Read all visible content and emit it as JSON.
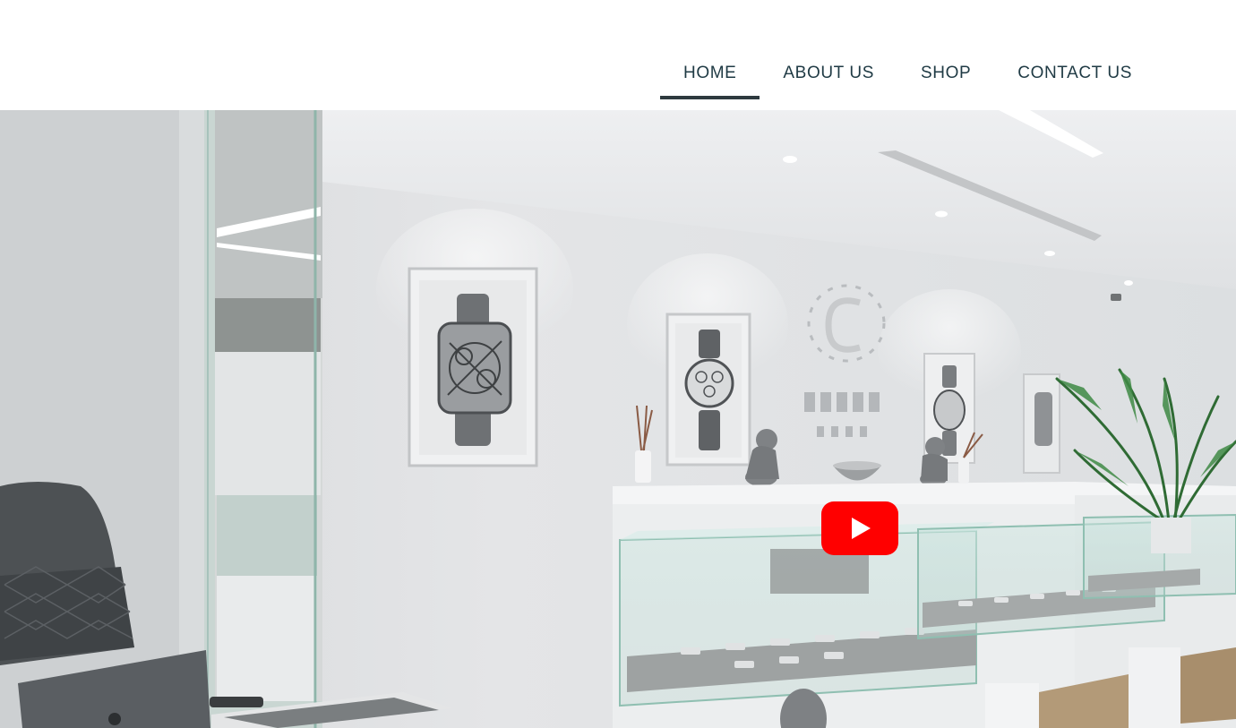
{
  "nav": {
    "items": [
      {
        "label": "HOME",
        "active": true
      },
      {
        "label": "ABOUT US",
        "active": false
      },
      {
        "label": "SHOP",
        "active": false
      },
      {
        "label": "CONTACT US",
        "active": false
      }
    ]
  },
  "video": {
    "play_icon": "youtube-play-icon",
    "play_color": "#ff0000"
  },
  "colors": {
    "nav_text": "#1f3a44",
    "active_underline": "#2e3a3f"
  }
}
